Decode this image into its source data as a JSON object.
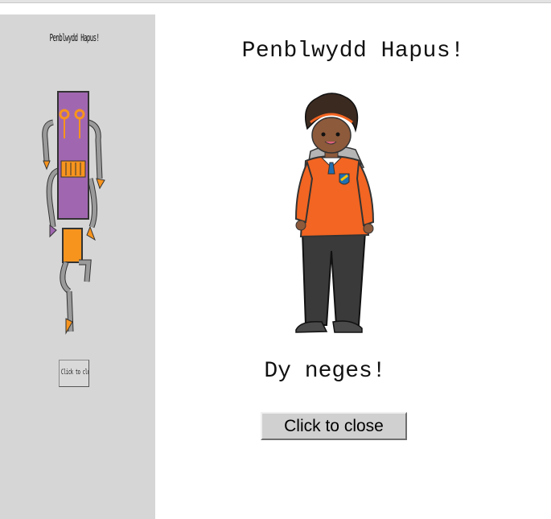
{
  "sidebar": {
    "thumbnail_title": "Penblwydd Hapus!",
    "thumbnail_button": "Click to close",
    "image": "robot-illustration"
  },
  "card": {
    "title": "Penblwydd Hapus!",
    "image": "student-illustration",
    "message": "Dy neges!",
    "close_button": "Click to close"
  },
  "colors": {
    "sidebar_bg": "#d6d6d6",
    "button_bg": "#d0d0d0",
    "robot_purple": "#a067b0",
    "robot_orange": "#f7941d",
    "jumper_orange": "#f26522"
  }
}
